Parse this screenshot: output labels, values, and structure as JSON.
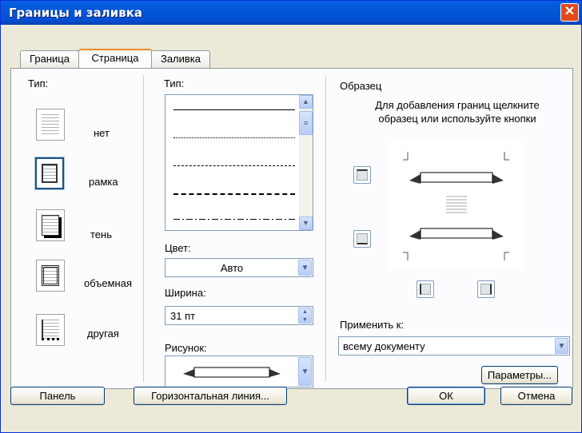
{
  "window": {
    "title": "Границы и заливка",
    "close": "✕"
  },
  "tabs": [
    {
      "label": "Граница"
    },
    {
      "label": "Страница"
    },
    {
      "label": "Заливка"
    }
  ],
  "settings": {
    "label": "Тип:",
    "items": [
      {
        "label": "нет"
      },
      {
        "label": "рамка"
      },
      {
        "label": "тень"
      },
      {
        "label": "объемная"
      },
      {
        "label": "другая"
      }
    ]
  },
  "style": {
    "label": "Тип:"
  },
  "color": {
    "label": "Цвет:",
    "value": "Авто"
  },
  "width": {
    "label": "Ширина:",
    "value": "31 пт"
  },
  "art": {
    "label": "Рисунок:"
  },
  "preview": {
    "label": "Образец",
    "hint": "Для добавления границ щелкните образец или используйте кнопки"
  },
  "apply": {
    "label": "Применить к:",
    "value": "всему документу"
  },
  "buttons": {
    "options": "Параметры...",
    "toolbar": "Панель",
    "hline": "Горизонтальная линия...",
    "ok": "ОК",
    "cancel": "Отмена"
  }
}
